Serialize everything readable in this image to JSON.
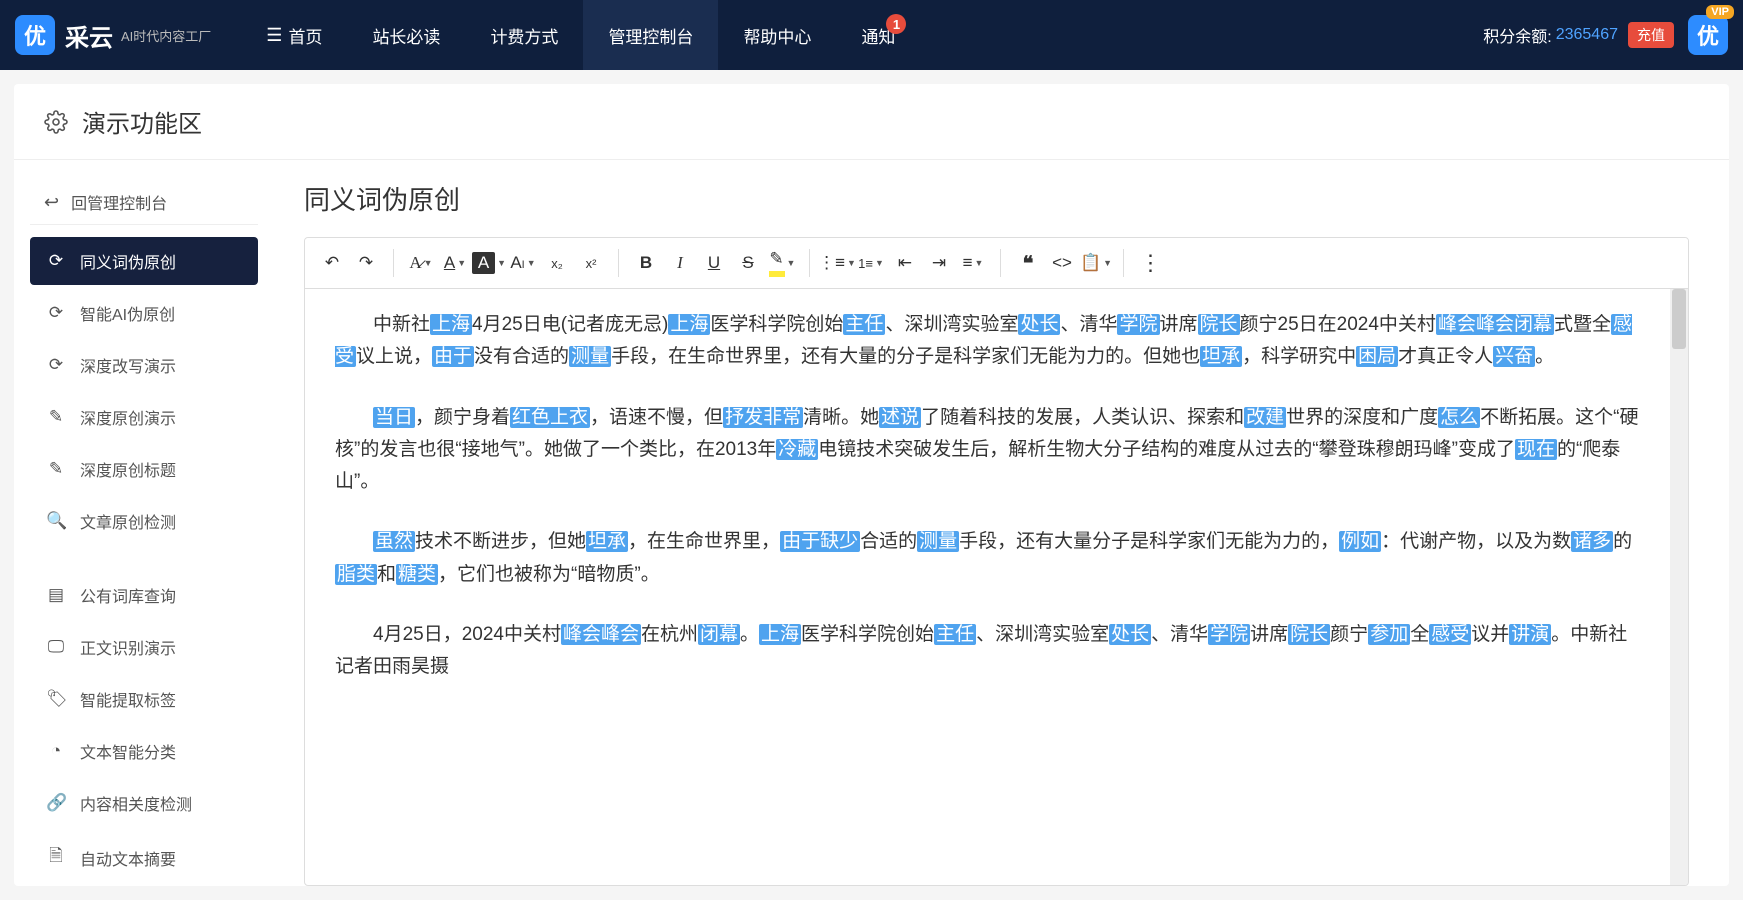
{
  "brand": {
    "logo_char": "优",
    "name": "采云",
    "tagline": "AI时代内容工厂"
  },
  "nav": {
    "items": [
      {
        "label": "首页",
        "has_icon": true
      },
      {
        "label": "站长必读"
      },
      {
        "label": "计费方式"
      },
      {
        "label": "管理控制台",
        "active": true
      },
      {
        "label": "帮助中心"
      },
      {
        "label": "通知",
        "badge": "1"
      }
    ]
  },
  "topright": {
    "points_label": "积分余额:",
    "points_value": "2365467",
    "recharge": "充值",
    "vip_char": "优",
    "vip_badge": "VIP"
  },
  "panel": {
    "title": "演示功能区"
  },
  "sidebar": {
    "back": "回管理控制台",
    "group1": [
      {
        "icon": "refresh",
        "label": "同义词伪原创",
        "active": true
      },
      {
        "icon": "refresh",
        "label": "智能AI伪原创"
      },
      {
        "icon": "refresh",
        "label": "深度改写演示"
      },
      {
        "icon": "edit",
        "label": "深度原创演示"
      },
      {
        "icon": "edit",
        "label": "深度原创标题"
      },
      {
        "icon": "search",
        "label": "文章原创检测"
      }
    ],
    "group2": [
      {
        "icon": "book",
        "label": "公有词库查询"
      },
      {
        "icon": "monitor",
        "label": "正文识别演示"
      },
      {
        "icon": "tag",
        "label": "智能提取标签"
      },
      {
        "icon": "pie",
        "label": "文本智能分类"
      },
      {
        "icon": "link",
        "label": "内容相关度检测"
      },
      {
        "icon": "doc",
        "label": "自动文本摘要"
      }
    ]
  },
  "content": {
    "title": "同义词伪原创",
    "paragraphs": [
      [
        {
          "t": "中新社"
        },
        {
          "t": "上海",
          "h": 1
        },
        {
          "t": "4月25日电(记者庞无忌)"
        },
        {
          "t": "上海",
          "h": 1
        },
        {
          "t": "医学科学院创始"
        },
        {
          "t": "主任",
          "h": 1
        },
        {
          "t": "、深圳湾实验室"
        },
        {
          "t": "处长",
          "h": 1
        },
        {
          "t": "、清华"
        },
        {
          "t": "学院",
          "h": 1
        },
        {
          "t": "讲席"
        },
        {
          "t": "院长",
          "h": 1
        },
        {
          "t": "颜宁25日在2024中关村"
        },
        {
          "t": "峰会峰会闭幕",
          "h": 1
        },
        {
          "t": "式暨全"
        },
        {
          "t": "感受",
          "h": 1
        },
        {
          "t": "议上说，"
        },
        {
          "t": "由于",
          "h": 1
        },
        {
          "t": "没有合适的"
        },
        {
          "t": "测量",
          "h": 1
        },
        {
          "t": "手段，在生命世界里，还有大量的分子是科学家们无能为力的。但她也"
        },
        {
          "t": "坦承",
          "h": 1
        },
        {
          "t": "，科学研究中"
        },
        {
          "t": "困局",
          "h": 1
        },
        {
          "t": "才真正令人"
        },
        {
          "t": "兴奋",
          "h": 1
        },
        {
          "t": "。"
        }
      ],
      [
        {
          "t": "当日",
          "h": 1
        },
        {
          "t": "，颜宁身着"
        },
        {
          "t": "红色上衣",
          "h": 1
        },
        {
          "t": "，语速不慢，但"
        },
        {
          "t": "抒发非常",
          "h": 1
        },
        {
          "t": "清晰。她"
        },
        {
          "t": "述说",
          "h": 1
        },
        {
          "t": "了随着科技的发展，人类认识、探索和"
        },
        {
          "t": "改建",
          "h": 1
        },
        {
          "t": "世界的深度和广度"
        },
        {
          "t": "怎么",
          "h": 1
        },
        {
          "t": "不断拓展。这个“硬核”的发言也很“接地气”。她做了一个类比，在2013年"
        },
        {
          "t": "冷藏",
          "h": 1
        },
        {
          "t": "电镜技术突破发生后，解析生物大分子结构的难度从过去的“攀登珠穆朗玛峰”变成了"
        },
        {
          "t": "现在",
          "h": 1
        },
        {
          "t": "的“爬泰山”。"
        }
      ],
      [
        {
          "t": "虽然",
          "h": 1
        },
        {
          "t": "技术不断进步，但她"
        },
        {
          "t": "坦承",
          "h": 1
        },
        {
          "t": "，在生命世界里，"
        },
        {
          "t": "由于缺少",
          "h": 1
        },
        {
          "t": "合适的"
        },
        {
          "t": "测量",
          "h": 1
        },
        {
          "t": "手段，还有大量分子是科学家们无能为力的，"
        },
        {
          "t": "例如",
          "h": 1
        },
        {
          "t": "：代谢产物，以及为数"
        },
        {
          "t": "诸多",
          "h": 1
        },
        {
          "t": "的"
        },
        {
          "t": "脂类",
          "h": 1
        },
        {
          "t": "和"
        },
        {
          "t": "糖类",
          "h": 1
        },
        {
          "t": "，它们也被称为“暗物质”。"
        }
      ],
      [
        {
          "t": "4月25日，2024中关村"
        },
        {
          "t": "峰会峰会",
          "h": 1
        },
        {
          "t": "在杭州"
        },
        {
          "t": "闭幕",
          "h": 1
        },
        {
          "t": "。"
        },
        {
          "t": "上海",
          "h": 1
        },
        {
          "t": "医学科学院创始"
        },
        {
          "t": "主任",
          "h": 1
        },
        {
          "t": "、深圳湾实验室"
        },
        {
          "t": "处长",
          "h": 1
        },
        {
          "t": "、清华"
        },
        {
          "t": "学院",
          "h": 1
        },
        {
          "t": "讲席"
        },
        {
          "t": "院长",
          "h": 1
        },
        {
          "t": "颜宁"
        },
        {
          "t": "参加",
          "h": 1
        },
        {
          "t": "全"
        },
        {
          "t": "感受",
          "h": 1
        },
        {
          "t": "议并"
        },
        {
          "t": "讲演",
          "h": 1
        },
        {
          "t": "。中新社记者田雨昊摄"
        }
      ]
    ]
  }
}
